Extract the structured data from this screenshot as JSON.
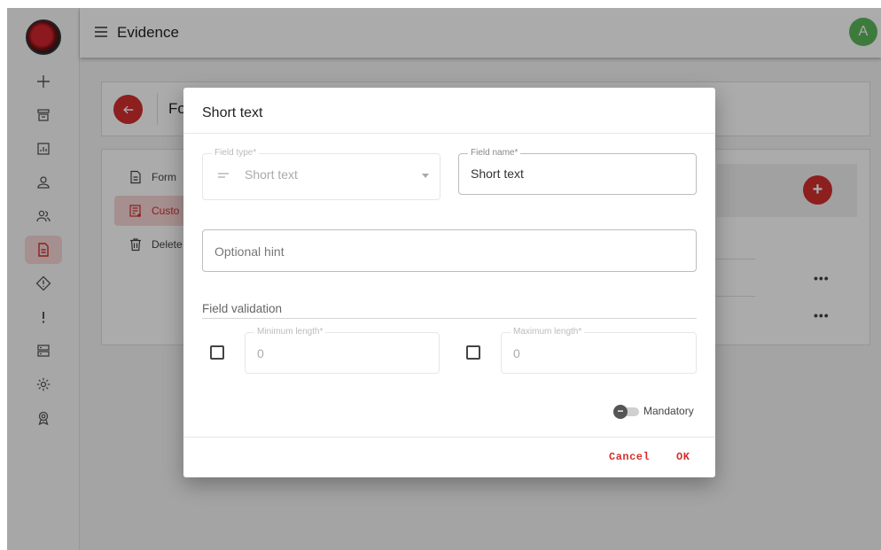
{
  "topbar": {
    "title": "Evidence",
    "avatar_initial": "A"
  },
  "sidebar": {
    "items": [
      {
        "icon": "plus-icon"
      },
      {
        "icon": "archive-icon"
      },
      {
        "icon": "chart-icon"
      },
      {
        "icon": "user-icon"
      },
      {
        "icon": "users-icon"
      },
      {
        "icon": "document-icon",
        "active": true
      },
      {
        "icon": "diamond-alert-icon"
      },
      {
        "icon": "exclamation-icon"
      },
      {
        "icon": "storage-icon"
      },
      {
        "icon": "gear-icon"
      },
      {
        "icon": "award-icon"
      }
    ]
  },
  "page": {
    "header_title": "Fo",
    "menu": [
      {
        "label": "Form",
        "icon": "file-icon"
      },
      {
        "label": "Custo",
        "icon": "custom-fields-icon",
        "active": true
      },
      {
        "label": "Delete",
        "icon": "trash-icon"
      }
    ],
    "row_actions": [
      "•••",
      "•••"
    ]
  },
  "dialog": {
    "title": "Short text",
    "field_type": {
      "label": "Field type*",
      "value": "Short text"
    },
    "field_name": {
      "label": "Field name*",
      "value": "Short text"
    },
    "hint": {
      "placeholder": "Optional hint"
    },
    "validation_label": "Field validation",
    "min_length": {
      "label": "Minimum length*",
      "value": "0",
      "checked": false
    },
    "max_length": {
      "label": "Maximum length*",
      "value": "0",
      "checked": false
    },
    "mandatory": {
      "label": "Mandatory",
      "on": false
    },
    "cancel_label": "Cancel",
    "ok_label": "OK"
  },
  "colors": {
    "accent": "#d32f2f",
    "avatar": "#5cb85c"
  }
}
